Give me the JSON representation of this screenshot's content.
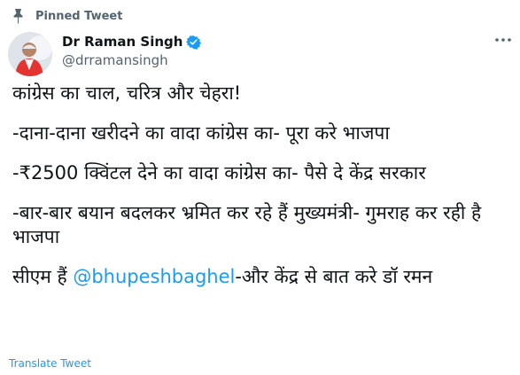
{
  "pinned": {
    "label": "Pinned Tweet",
    "icon": "pin-icon"
  },
  "author": {
    "display_name": "Dr Raman Singh",
    "handle": "@drramansingh",
    "verified_icon": "verified-badge-icon",
    "avatar_icon": "profile-avatar"
  },
  "menu": {
    "icon": "more-options-icon"
  },
  "tweet": {
    "line1": "कांग्रेस का चाल, चरित्र और चेहरा!",
    "line2": "-दाना-दाना खरीदने का वादा कांग्रेस का- पूरा करे भाजपा",
    "line3": "-₹2500 क्विंटल देने का वादा कांग्रेस का- पैसे दे केंद्र सरकार",
    "line4": "-बार-बार बयान बदलकर भ्रमित कर रहे हैं मुख्यमंत्री- गुमराह कर रही है भाजपा",
    "line5_prefix": "सीएम हैं ",
    "line5_mention": "@bhupeshbaghel",
    "line5_suffix": "-और केंद्र से बात करे डॉ रमन"
  },
  "translate_label": "Translate Tweet",
  "colors": {
    "accent": "#1d9bf0",
    "secondary_text": "#536471",
    "primary_text": "#0f1419"
  }
}
